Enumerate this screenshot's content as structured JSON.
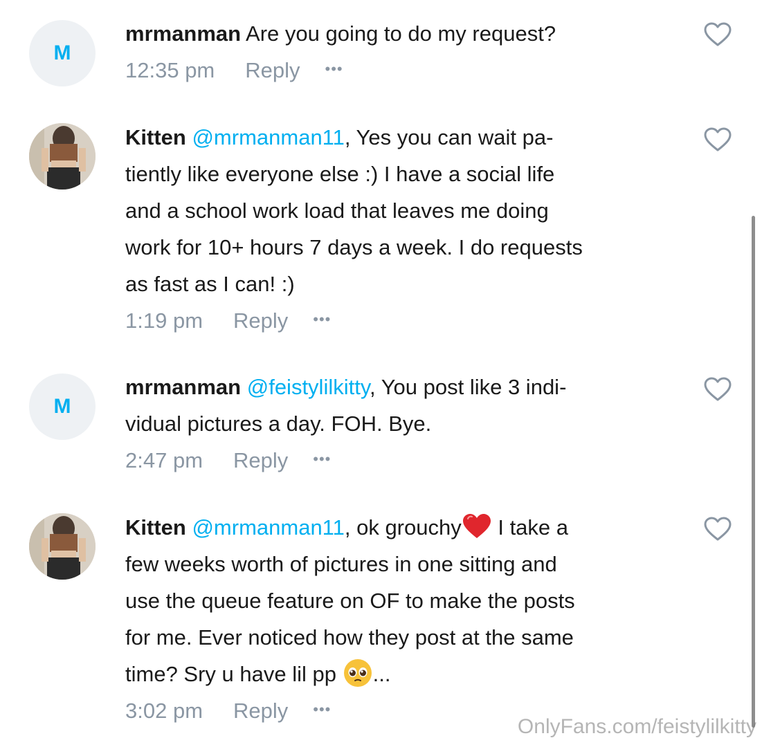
{
  "comments": [
    {
      "avatar_letter": "M",
      "author": "mrmanman",
      "mention": "",
      "text": "Are you going to do my request?",
      "time": "12:35 pm",
      "reply_label": "Reply",
      "more_label": "•••"
    },
    {
      "author": "Kitten",
      "mention": "@mrmanman11",
      "text_line1": ", Yes you can wait pa-",
      "text_line2": "tiently like everyone else :) I have a social life",
      "text_line3": "and a school work load that leaves me doing",
      "text_line4": "work for 10+ hours 7 days a week. I do requests",
      "text_line5": "as fast as I can! :)",
      "time": "1:19 pm",
      "reply_label": "Reply",
      "more_label": "•••"
    },
    {
      "avatar_letter": "M",
      "author": "mrmanman",
      "mention": "@feistylilkitty",
      "text_line1": ", You post like 3 indi-",
      "text_line2": "vidual pictures a day. FOH. Bye.",
      "time": "2:47 pm",
      "reply_label": "Reply",
      "more_label": "•••"
    },
    {
      "author": "Kitten",
      "mention": "@mrmanman11",
      "text_line1a": ", ok grouchy",
      "text_line1b": " I take a",
      "text_line2": "few weeks worth of pictures in one sitting and",
      "text_line3": "use the queue feature on OF to make the posts",
      "text_line4": "for me. Ever noticed how they post at the same",
      "text_line5a": "time? Sry u have lil pp ",
      "text_line5b": "...",
      "time": "3:02 pm",
      "reply_label": "Reply",
      "more_label": "•••"
    }
  ],
  "watermark": "OnlyFans.com/feistylilkitty",
  "colors": {
    "mention": "#00aff0",
    "meta": "#8a96a3",
    "avatar_bg": "#eef1f4"
  }
}
